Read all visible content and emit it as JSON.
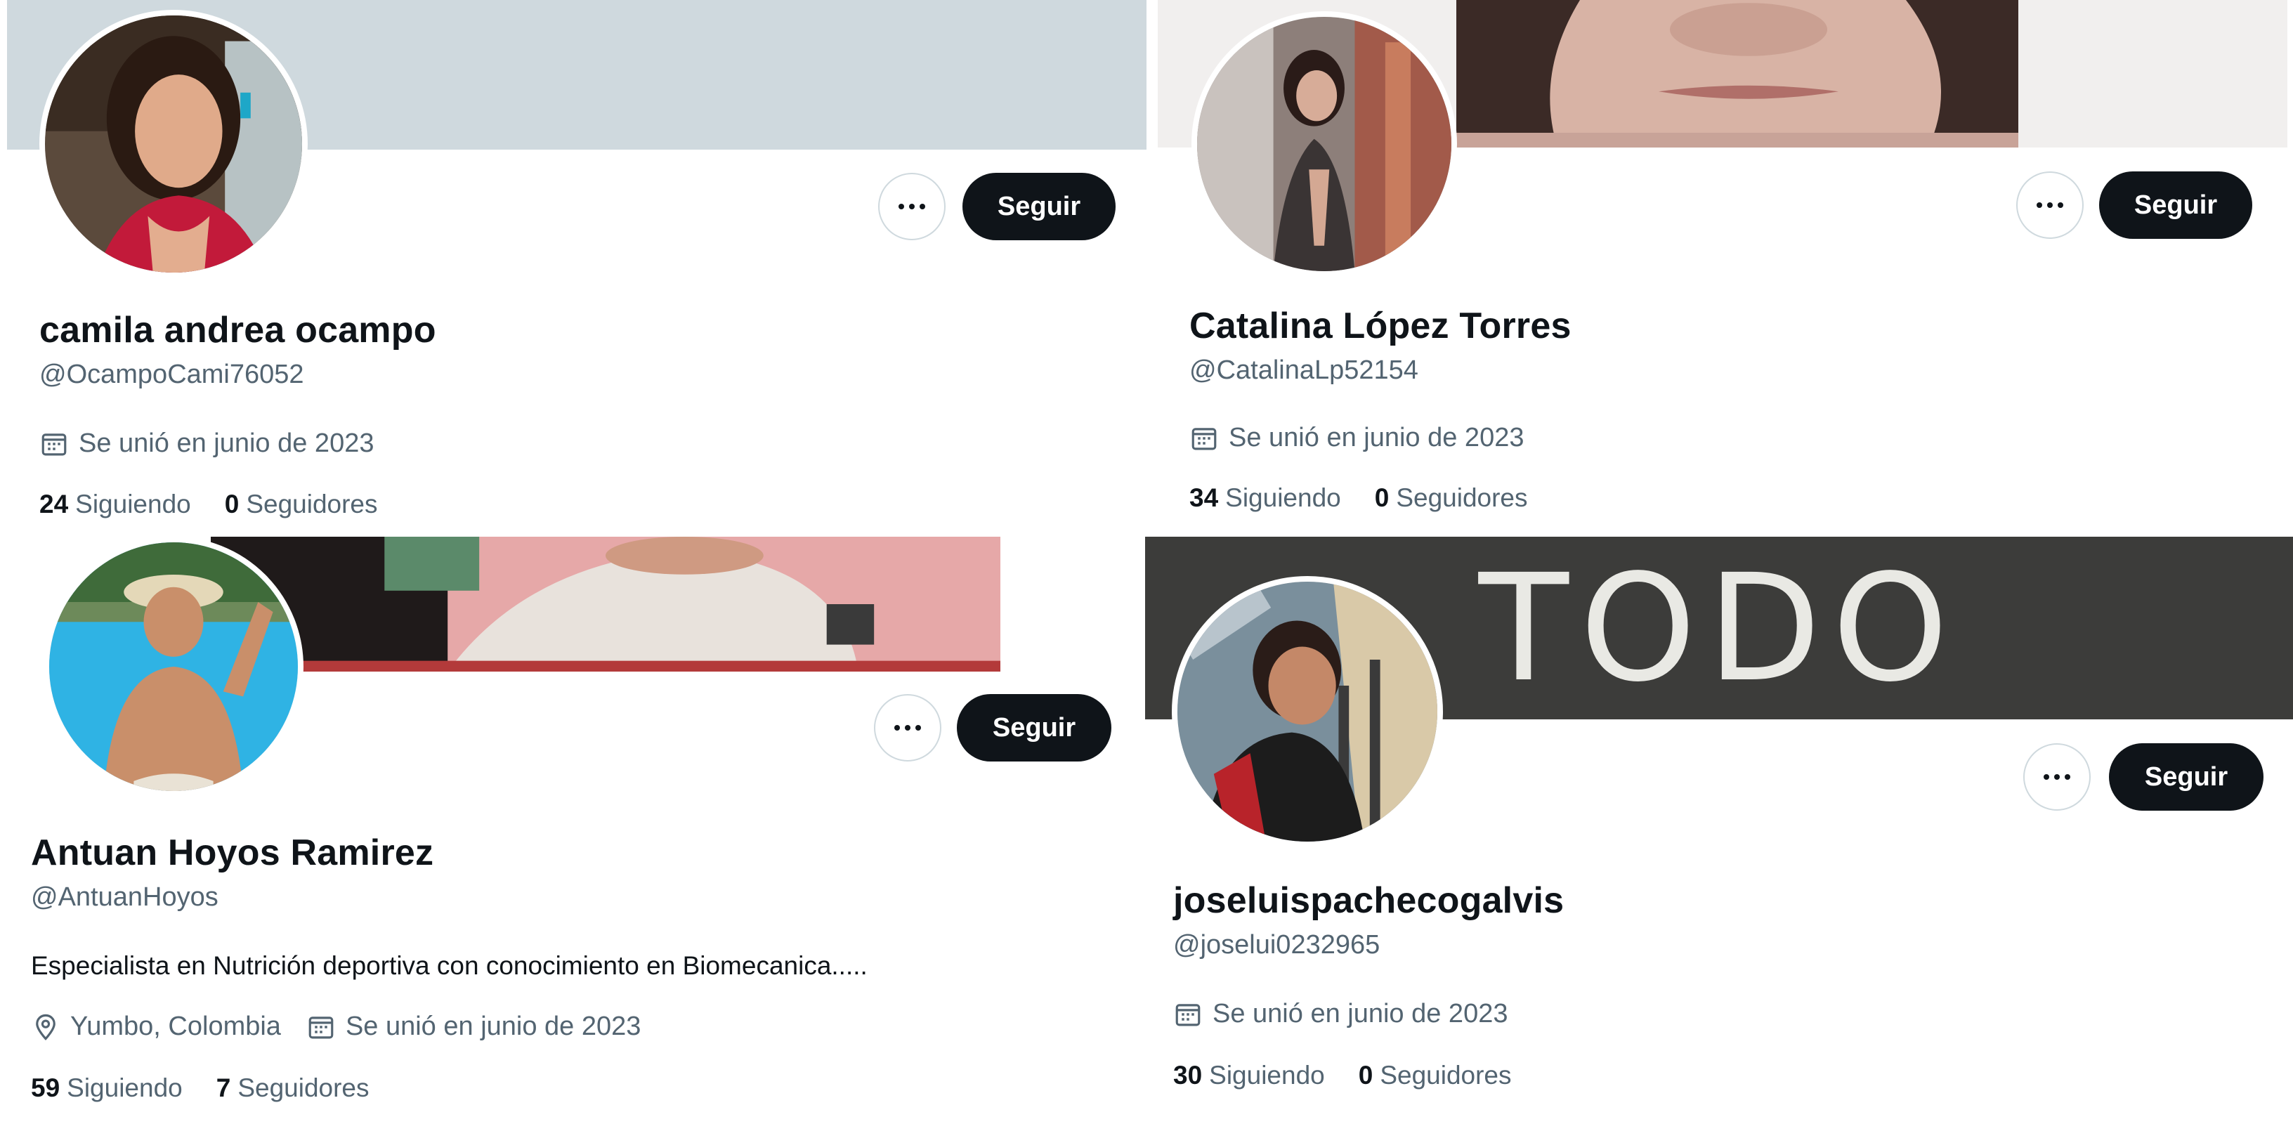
{
  "profiles": [
    {
      "name": "camila andrea ocampo",
      "handle": "@OcampoCami76052",
      "follow_label": "Seguir",
      "joined": "Se unió en junio de 2023",
      "following_count": "24",
      "following_label": "Siguiendo",
      "followers_count": "0",
      "followers_label": "Seguidores"
    },
    {
      "name": "Catalina López Torres",
      "handle": "@CatalinaLp52154",
      "follow_label": "Seguir",
      "joined": "Se unió en junio de 2023",
      "following_count": "34",
      "following_label": "Siguiendo",
      "followers_count": "0",
      "followers_label": "Seguidores"
    },
    {
      "name": "Antuan Hoyos Ramirez",
      "handle": "@AntuanHoyos",
      "bio": "Especialista en Nutrición deportiva con conocimiento en Biomecanica.....",
      "location": "Yumbo, Colombia",
      "follow_label": "Seguir",
      "joined": "Se unió en junio de 2023",
      "following_count": "59",
      "following_label": "Siguiendo",
      "followers_count": "7",
      "followers_label": "Seguidores"
    },
    {
      "name": "joseluispachecogalvis",
      "handle": "@joselui0232965",
      "banner_text": "TODO",
      "follow_label": "Seguir",
      "joined": "Se unió en junio de 2023",
      "following_count": "30",
      "following_label": "Siguiendo",
      "followers_count": "0",
      "followers_label": "Seguidores"
    }
  ],
  "icons": {
    "more": "more-horizontal-icon",
    "calendar": "calendar-icon",
    "location": "location-pin-icon"
  },
  "colors": {
    "follow_button": "#0f1419",
    "secondary_text": "#536471",
    "banner_gray": "#cfd9de"
  }
}
